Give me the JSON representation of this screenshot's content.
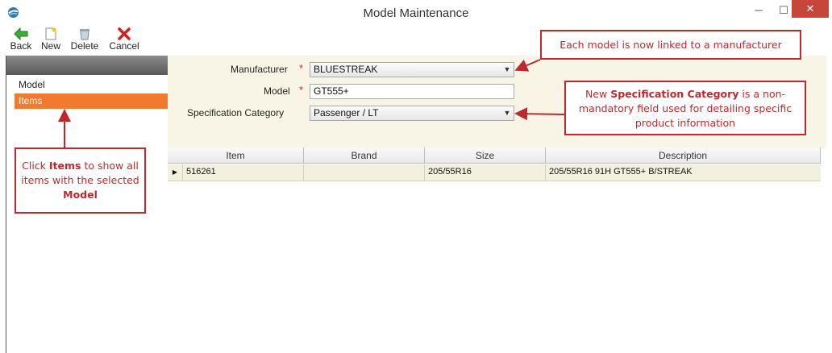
{
  "window": {
    "title": "Model Maintenance",
    "minimize": "─",
    "maximize": "☐",
    "close": "✕"
  },
  "toolbar": {
    "back": "Back",
    "new": "New",
    "delete": "Delete",
    "cancel": "Cancel"
  },
  "nav": {
    "model": "Model",
    "items": "Items"
  },
  "form": {
    "manufacturer_label": "Manufacturer",
    "manufacturer_value": "BLUESTREAK",
    "model_label": "Model",
    "model_value": "GT555+",
    "spec_label": "Specification Category",
    "spec_value": "Passenger / LT",
    "required_mark": "*"
  },
  "grid": {
    "columns": [
      "Item",
      "Brand",
      "Size",
      "Description"
    ],
    "rows": [
      {
        "item": "516261",
        "brand": "",
        "size": "205/55R16",
        "description": "205/55R16 91H GT555+ B/STREAK"
      }
    ]
  },
  "callouts": {
    "manufacturer_note": "Each model is now linked to a manufacturer",
    "spec_note_pre": "New ",
    "spec_note_bold": "Specification Category",
    "spec_note_post": " is a non-mandatory field used for detailing specific product information",
    "items_note_pre": "Click ",
    "items_note_bold": "Items",
    "items_note_mid": " to show all items with the selected ",
    "items_note_bold2": "Model"
  },
  "colors": {
    "accent": "#f07a2e",
    "callout": "#c0282d",
    "close": "#c7463c",
    "form_bg": "#f8f5e6"
  }
}
